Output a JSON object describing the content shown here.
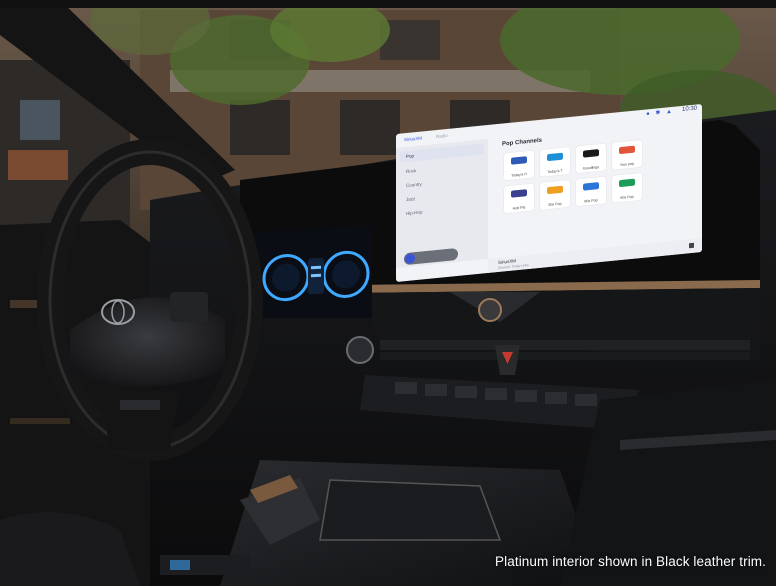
{
  "caption": "Platinum interior shown in Black leather trim.",
  "screen": {
    "clock": "10:30",
    "status_icons": "wifi-icon bluetooth-icon signal-icon",
    "sidebar_tab_active": "SiriusXM",
    "sidebar_tab_other": "Radio",
    "sidebar_items": [
      "Pop",
      "Rock",
      "Country",
      "Jazz",
      "Hip-Hop"
    ],
    "section_title": "Pop Channels",
    "tiles": [
      {
        "label": "Today's H",
        "color": "#2f5bb8"
      },
      {
        "label": "Today's T",
        "color": "#1f8fd8"
      },
      {
        "label": "Goodlings",
        "color": "#1a1a1a"
      },
      {
        "label": "Your pop",
        "color": "#e2553a"
      },
      {
        "label": "Hott Pla",
        "color": "#3a3f8f"
      },
      {
        "label": "90s Pop",
        "color": "#f0a020"
      },
      {
        "label": "80s Pop",
        "color": "#2a75d8"
      },
      {
        "label": "60s Pop",
        "color": "#1d9b5a"
      }
    ],
    "now_playing_title": "SiriusXM",
    "now_playing_sub": "Channel: Today's Hits"
  },
  "colors": {
    "screen_bg": "#f2f3f6",
    "accent_blue": "#3a56d4",
    "gauge_blue": "#3fa8ff"
  }
}
